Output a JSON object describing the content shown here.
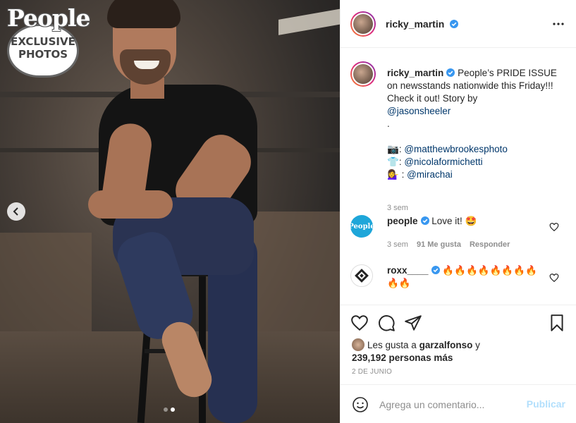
{
  "photo": {
    "badge_logo": "People",
    "badge_line1": "EXCLUSIVE",
    "badge_line2": "PHOTOS",
    "carousel_dots": 2,
    "carousel_active": 2
  },
  "header": {
    "username": "ricky_martin",
    "verified": true
  },
  "caption": {
    "username": "ricky_martin",
    "text": "People’s PRIDE ISSUE on newsstands nationwide this Friday!!! Check it out! Story by",
    "mention_story": "@jasonsheeler",
    "dot": ".",
    "credits": [
      {
        "emoji": "📷",
        "sep": ":",
        "handle": "@matthewbrookesphoto"
      },
      {
        "emoji": "👕",
        "sep": ":",
        "handle": "@nicolaformichetti"
      },
      {
        "emoji": "💁‍♀️",
        "sep": " : ",
        "handle": "@mirachai"
      }
    ],
    "time": "3 sem"
  },
  "comments": [
    {
      "username": "people",
      "text": "Love it! 🤩",
      "time": "3 sem",
      "likes": "91 Me gusta",
      "reply": "Responder",
      "avatar_text": "People"
    },
    {
      "username": "roxx____",
      "text": "🔥🔥🔥🔥🔥🔥🔥🔥🔥🔥"
    }
  ],
  "likes": {
    "prefix": "Les gusta a",
    "user": "garzalfonso",
    "joiner": "y",
    "count": "239,192 personas más"
  },
  "date": "2 DE JUNIO",
  "add_comment": {
    "placeholder": "Agrega un comentario...",
    "publish": "Publicar"
  },
  "colors": {
    "link": "#00376b",
    "verified": "#3897f0",
    "publish_disabled": "#b2dffc",
    "muted": "#8e8e8e"
  }
}
